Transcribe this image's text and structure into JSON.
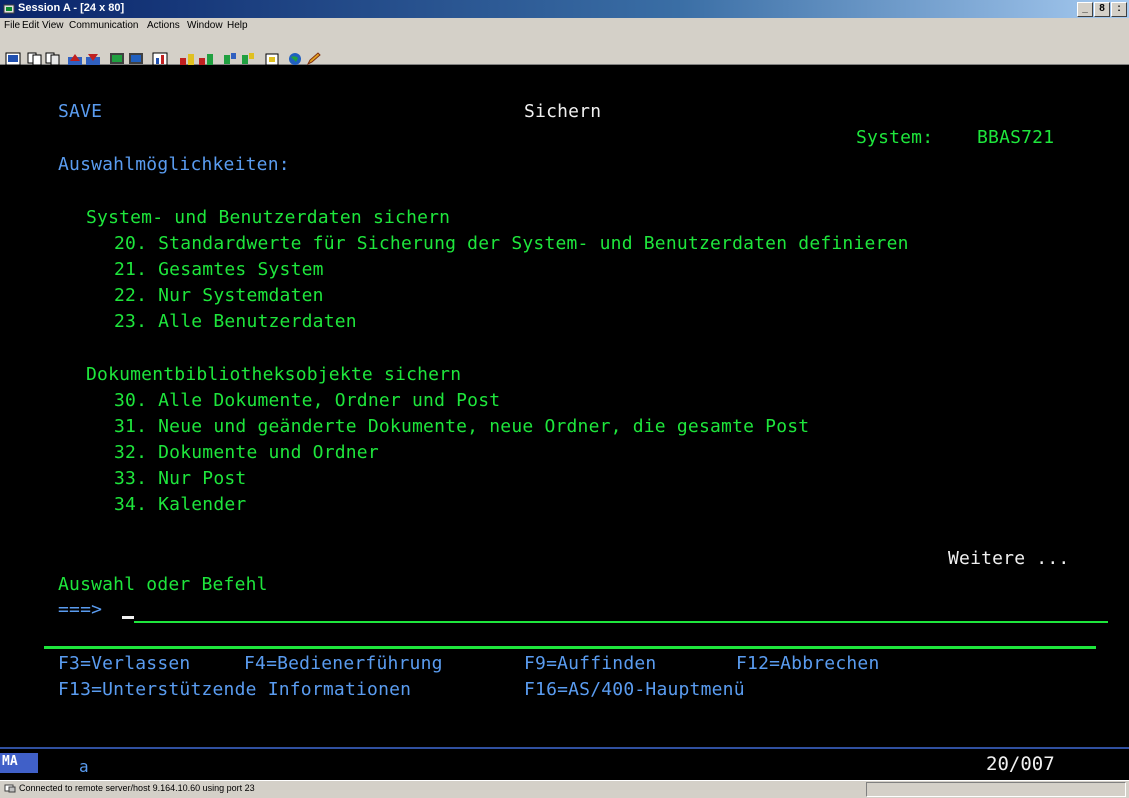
{
  "window": {
    "title": "Session A - [24 x 80]",
    "controls": [
      "_",
      "8",
      ":"
    ]
  },
  "menu": [
    "File",
    "Edit",
    "View",
    "Communication",
    "Actions",
    "Window",
    "Help"
  ],
  "toolbar": {
    "icons": [
      "print-screen-icon",
      "copy-icon",
      "paste-icon",
      "send-icon",
      "receive-icon",
      "display-icon",
      "keyboard-icon",
      "chart-icon",
      "macro-record-icon",
      "macro-play-icon",
      "macro-stop-icon",
      "macro-run-icon",
      "clipboard-icon",
      "globe-icon",
      "pencil-icon"
    ]
  },
  "screen": {
    "menu_name": "SAVE",
    "title": "Sichern",
    "system_label": "System:",
    "system_name": "BBAS721",
    "options_heading": "Auswahlmöglichkeiten:",
    "groups": [
      {
        "heading": "System- und Benutzerdaten sichern",
        "items": [
          "20. Standardwerte für Sicherung der System- und Benutzerdaten definieren",
          "21. Gesamtes System",
          "22. Nur Systemdaten",
          "23. Alle Benutzerdaten"
        ]
      },
      {
        "heading": "Dokumentbibliotheksobjekte sichern",
        "items": [
          "30. Alle Dokumente, Ordner und Post",
          "31. Neue und geänderte Dokumente, neue Ordner, die gesamte Post",
          "32. Dokumente und Ordner",
          "33. Nur Post",
          "34. Kalender"
        ]
      }
    ],
    "more": "Weitere ...",
    "prompt_label": "Auswahl oder Befehl",
    "prompt_arrow": "===>",
    "command_value": "",
    "fkeys_row1": [
      "F3=Verlassen",
      "F4=Bedienerführung",
      "F9=Auffinden",
      "F12=Abbrechen"
    ],
    "fkeys_row2": [
      "F13=Unterstützende Informationen",
      "F16=AS/400-Hauptmenü"
    ]
  },
  "oia": {
    "indicator": "MA",
    "mode": "a",
    "cursor_position": "20/007"
  },
  "status": {
    "text": "Connected to remote server/host 9.164.10.60 using port 23"
  },
  "colors": {
    "terminal_green": "#1ee63c",
    "terminal_white": "#f0f0f0",
    "terminal_blue": "#5a9cf0",
    "background": "#000000"
  }
}
